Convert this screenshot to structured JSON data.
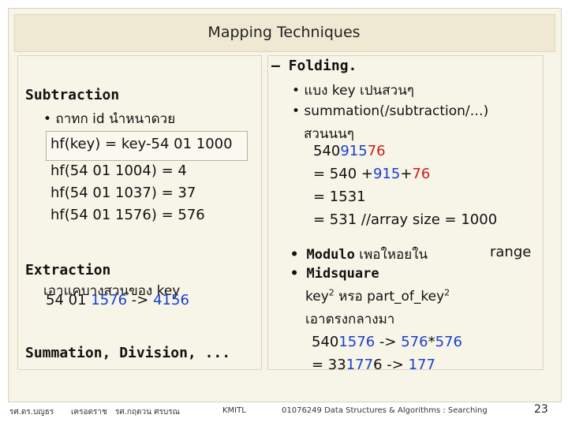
{
  "title": "Mapping Techniques",
  "left": {
    "subtraction_heading": "Subtraction",
    "subtraction_bullet": "• ถาทก     id นำหนาดวย",
    "formula": "hf(key) = key-54 01 1000",
    "calcs": [
      "hf(54 01 1004) = 4",
      "hf(54 01 1037) = 37",
      "hf(54 01 1576) = 576"
    ],
    "extraction_heading": "Extraction",
    "extraction_desc": "เอาแคบางสวนของ      key",
    "extraction_example_prefix": "54 01 ",
    "extraction_example_mid": "1576",
    "extraction_example_arrow": " -> ",
    "extraction_example_result": "4156",
    "summation_heading": "Summation, Division, ..."
  },
  "right": {
    "folding_heading": "–  Folding.",
    "folding_b1": "• แบง   key เปนสวนๆ",
    "folding_b2": "• summation(/subtraction/…)",
    "folding_b2_cont": "สวนนนๆ",
    "num_a": "540",
    "num_b": "915",
    "num_c": "76",
    "line2_prefix": "= 540 +",
    "line2_mid": "915",
    "line2_plus": "+",
    "line2_end": "76",
    "line3": "= 1531",
    "line4": "= 531    //array size = 1000",
    "modulo_label": "• Modulo",
    "modulo_text": " เพอใหอยใน",
    "range_text": "range",
    "midsquare_label": "• Midsquare",
    "midsquare_desc_a": "key",
    "midsquare_desc_b": " หรอ   part_of_key",
    "midsquare_desc_sup": "2",
    "midsquare_thai": "เอาตรงกลางมา",
    "ms_line1_a": "540",
    "ms_line1_b": "1576",
    "ms_line1_c": " -> ",
    "ms_line1_d": "576",
    "ms_line1_e": "*",
    "ms_line1_f": "576",
    "ms_line2_a": "= 33",
    "ms_line2_b": "177",
    "ms_line2_c": "6 -> ",
    "ms_line2_d": "177"
  },
  "footer": {
    "author1": "รศ.ดร.บญธร",
    "author2": "เครอตราช",
    "author3": "รศ.กฤตวน  ศรบรณ",
    "org": "KMITL",
    "course": "01076249 Data Structures & Algorithms : Searching",
    "page": "23"
  },
  "colors": {
    "accent_blue": "#1a3fd0",
    "accent_red": "#c81e1e"
  }
}
